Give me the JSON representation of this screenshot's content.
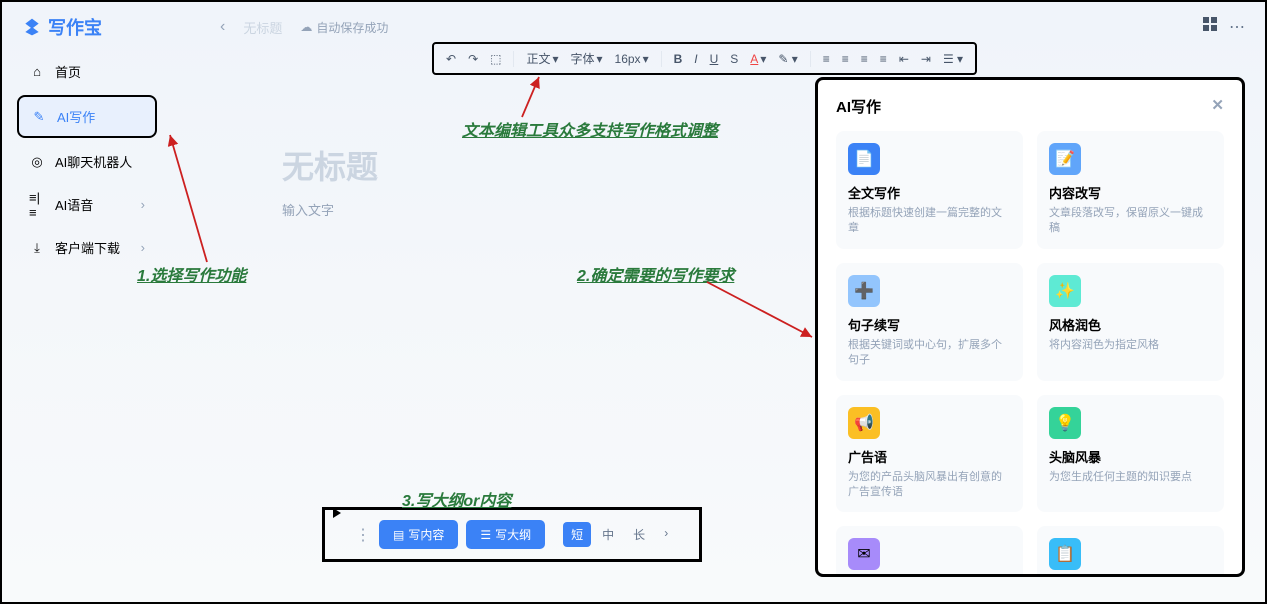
{
  "brand": "写作宝",
  "top": {
    "doc_title": "无标题",
    "autosave": "自动保存成功"
  },
  "sidebar": {
    "items": [
      {
        "label": "首页"
      },
      {
        "label": "AI写作"
      },
      {
        "label": "AI聊天机器人"
      },
      {
        "label": "AI语音"
      },
      {
        "label": "客户端下载"
      }
    ]
  },
  "toolbar": {
    "style": "正文",
    "font": "字体",
    "size": "16px"
  },
  "editor": {
    "title": "无标题",
    "placeholder": "输入文字"
  },
  "bottom": {
    "write_content": "写内容",
    "write_outline": "写大纲",
    "len_short": "短",
    "len_mid": "中",
    "len_long": "长"
  },
  "ai_panel": {
    "title": "AI写作",
    "cards": [
      {
        "title": "全文写作",
        "desc": "根据标题快速创建一篇完整的文章",
        "color": "#3b82f6"
      },
      {
        "title": "内容改写",
        "desc": "文章段落改写，保留原义一键成稿",
        "color": "#60a5fa"
      },
      {
        "title": "句子续写",
        "desc": "根据关键词或中心句，扩展多个句子",
        "color": "#93c5fd"
      },
      {
        "title": "风格润色",
        "desc": "将内容润色为指定风格",
        "color": "#5eead4"
      },
      {
        "title": "广告语",
        "desc": "为您的产品头脑风暴出有创意的广告宣传语",
        "color": "#fbbf24"
      },
      {
        "title": "头脑风暴",
        "desc": "为您生成任何主题的知识要点",
        "color": "#34d399"
      },
      {
        "title": "",
        "desc": "",
        "color": "#a78bfa"
      },
      {
        "title": "",
        "desc": "",
        "color": "#38bdf8"
      }
    ]
  },
  "annotations": {
    "a1": "1.选择写作功能",
    "a2": "2.确定需要的写作要求",
    "a3": "3.写大纲or内容",
    "toolbar_note": "文本编辑工具众多支持写作格式调整"
  }
}
